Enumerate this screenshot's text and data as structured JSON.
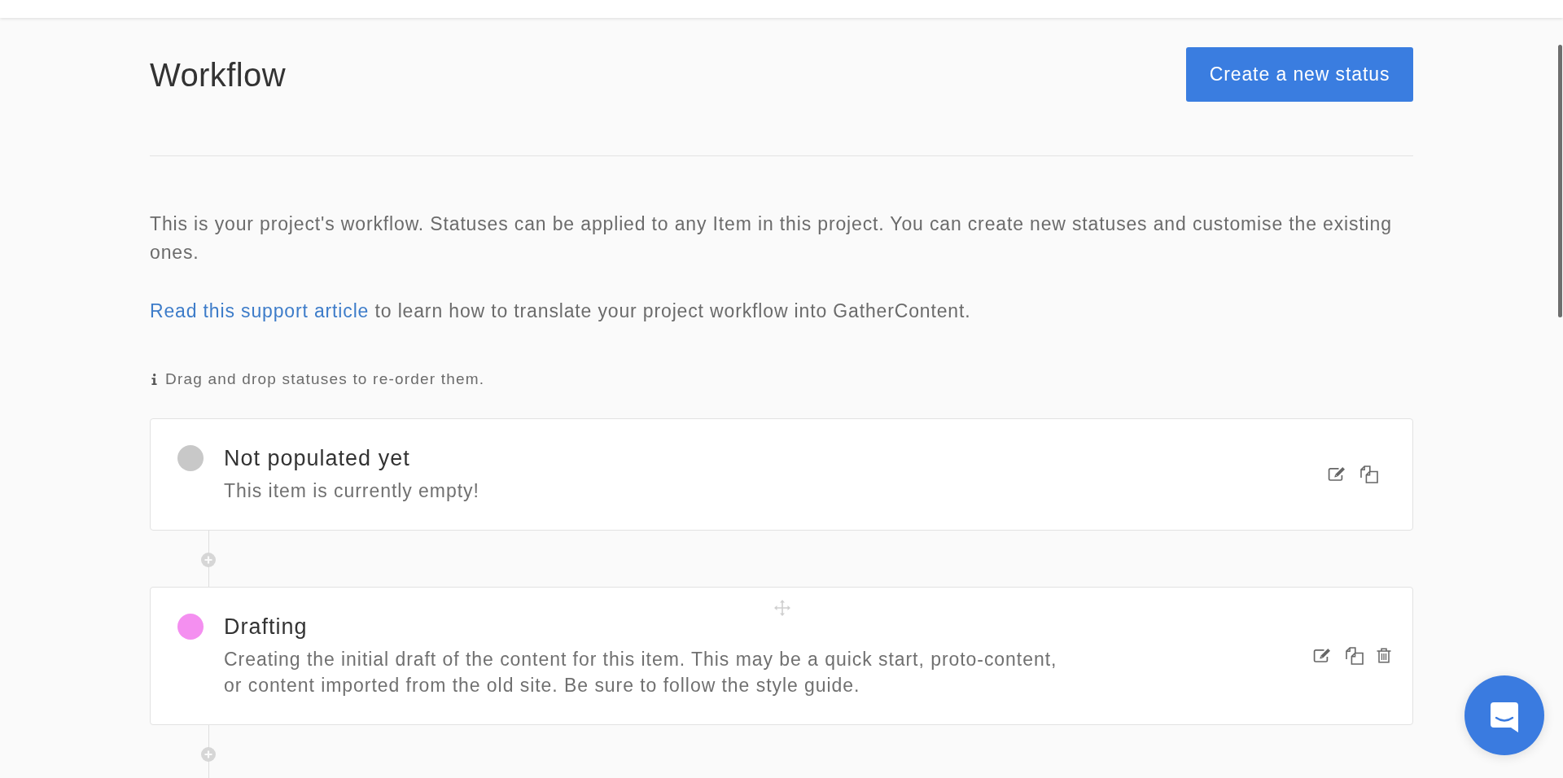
{
  "header": {
    "title": "Workflow",
    "button": "Create a new status"
  },
  "intro": "This is your project's workflow. Statuses can be applied to any Item in this project. You can create new statuses and customise the existing ones.",
  "support": {
    "link": "Read this support article",
    "text": "to learn how to translate your project workflow into GatherContent."
  },
  "hint": "Drag and drop statuses to re-order them.",
  "statuses": [
    {
      "name": "Not populated yet",
      "description": "This item is currently empty!",
      "color": "#c8c8c8",
      "hovered": false,
      "deletable": false
    },
    {
      "name": "Drafting",
      "description": "Creating the initial draft of the content for this item. This may be a quick start, proto-content, or content imported from the old site. Be sure to follow the style guide.",
      "color": "#f48ff0",
      "hovered": true,
      "deletable": true
    }
  ]
}
